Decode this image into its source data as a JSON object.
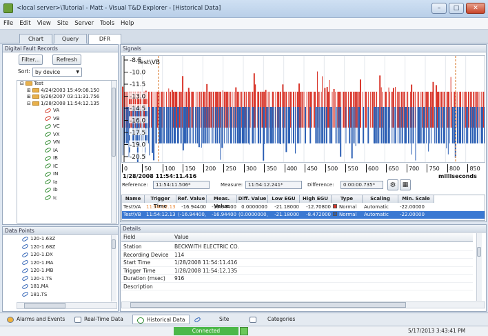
{
  "window": {
    "title": "<local server>\\Tutorial - Matt - Visual T&D Explorer - [Historical Data]"
  },
  "menu": [
    "File",
    "Edit",
    "View",
    "Site",
    "Server",
    "Tools",
    "Help"
  ],
  "tabs": [
    "Chart",
    "Query",
    "DFR"
  ],
  "active_tab": "DFR",
  "dfr_panel": {
    "title": "Digital Fault Records",
    "filter_label": "Filter...",
    "refresh_label": "Refresh",
    "sort_label": "Sort:",
    "sort_value": "by device",
    "tree": {
      "root": "Test",
      "records": [
        "4/24/2003 15:49:08.150",
        "9/26/2007 03:11:31.756",
        "1/28/2008 11:54:12.135"
      ],
      "channels": [
        "VA",
        "VB",
        "VC",
        "VX",
        "VN",
        "IA",
        "IB",
        "IC",
        "IN",
        "Ia",
        "Ib",
        "Ic"
      ]
    }
  },
  "points_panel": {
    "title": "Data Points",
    "items": [
      "120-1.63Z",
      "120-1.68Z",
      "120-1.DX",
      "120-1.MA",
      "120-1.MB",
      "120-1.TS",
      "181.MA",
      "181.TS"
    ]
  },
  "signals_panel": {
    "title": "Signals",
    "reference_label": "Reference:",
    "reference_value": "11:54:11.506*",
    "measure_label": "Measure:",
    "measure_value": "11:54:12.241*",
    "difference_label": "Difference:",
    "difference_value": "0:00:00.735*",
    "columns": [
      "Name",
      "Trigger Time",
      "Ref. Value",
      "Meas. Value",
      "Diff. Value",
      "Low EGU",
      "High EGU",
      "Type",
      "Scaling",
      "Min. Scale"
    ],
    "rows": [
      {
        "name": "Test\\VA",
        "trigger": "11:54:12.135*",
        "ref": "-16.94400",
        "meas": "-16.94400",
        "diff": "0.0000000",
        "low": "-21.18000",
        "high": "-12.70800",
        "color": "#d9372c",
        "type": "Normal",
        "scaling": "Automatic",
        "min": "-22.00000"
      },
      {
        "name": "Test\\VB",
        "trigger": "11:54:12.135*",
        "ref": "(-16.94400,",
        "meas": "-16.94400",
        "diff": "(0.0000000,",
        "low": "-21.18000",
        "high": "-8.472000",
        "color": "#2b5fb4",
        "type": "Normal",
        "scaling": "Automatic",
        "min": "-22.00000"
      }
    ]
  },
  "chart_data": {
    "type": "line",
    "title": "",
    "legend_label": "Test\\VB",
    "date_label": "1/28/2008 11:54:11.416",
    "xlabel": "milliseconds",
    "x_ticks": [
      "0",
      "50",
      "100",
      "150",
      "200",
      "250",
      "300",
      "350",
      "400",
      "450",
      "500",
      "550",
      "600",
      "650",
      "700",
      "750",
      "800",
      "850",
      "9"
    ],
    "y_ticks": [
      "-8.5",
      "-10.0",
      "-11.5",
      "-13.0",
      "-14.5",
      "-16.0",
      "-17.5",
      "-19.0",
      "-20.5"
    ],
    "xlim": [
      0,
      900
    ],
    "ylim": [
      -21.18,
      -8.472
    ],
    "series": [
      {
        "name": "Test\\VA",
        "color": "#d9372c",
        "band": [
          -12.7,
          -16.94
        ]
      },
      {
        "name": "Test\\VB",
        "color": "#2b5fb4",
        "band": [
          -14.5,
          -18.8
        ]
      }
    ],
    "cursors": [
      {
        "color": "#e4a06a"
      },
      {
        "color": "#e4a06a"
      }
    ]
  },
  "details_panel": {
    "title": "Details",
    "header": {
      "field": "Field",
      "value": "Value"
    },
    "rows": [
      {
        "field": "Station",
        "value": "BECKWITH ELECTRIC CO."
      },
      {
        "field": "Recording Device",
        "value": "114"
      },
      {
        "field": "Start Time",
        "value": "1/28/2008 11:54:11.416"
      },
      {
        "field": "Trigger Time",
        "value": "1/28/2008 11:54:12.135"
      },
      {
        "field": "Duration (msec)",
        "value": "916"
      },
      {
        "field": "Description",
        "value": ""
      }
    ]
  },
  "bottom_tabs": [
    "Alarms and Events",
    "Real-Time Data",
    "Historical Data",
    "Site",
    "Categories"
  ],
  "status": {
    "connection": "Connected",
    "connection_color": "#4cb848",
    "datetime": "5/17/2013 3:43:41 PM"
  }
}
